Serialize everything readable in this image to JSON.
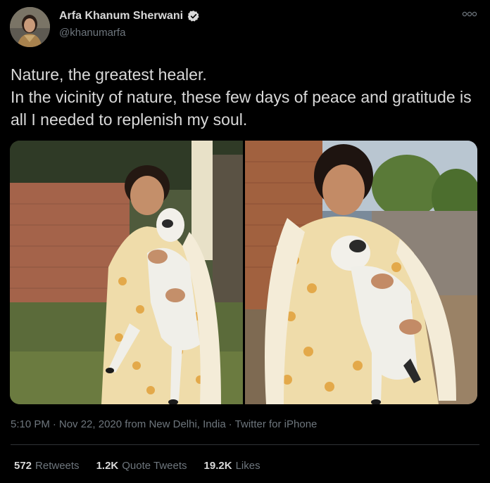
{
  "author": {
    "display_name": "Arfa Khanum Sherwani",
    "handle": "@khanumarfa",
    "verified_icon": "verified-badge-icon",
    "avatar_icon": "avatar"
  },
  "tweet": {
    "lines": [
      "Nature, the greatest healer.",
      "In the vicinity of nature, these few days of peace and gratitude is all I needed to replenish my soul."
    ]
  },
  "meta": {
    "time": "5:10 PM",
    "sep1": "·",
    "date": "Nov 22, 2020 from New Delhi, India",
    "sep2": "·",
    "client": "Twitter for iPhone"
  },
  "stats": [
    {
      "count": "572",
      "label": "Retweets"
    },
    {
      "count": "1.2K",
      "label": "Quote Tweets"
    },
    {
      "count": "19.2K",
      "label": "Likes"
    }
  ],
  "colors": {
    "background": "#000000",
    "text": "#d9d9d9",
    "secondary": "#6e767d",
    "divider": "#2f3336"
  }
}
